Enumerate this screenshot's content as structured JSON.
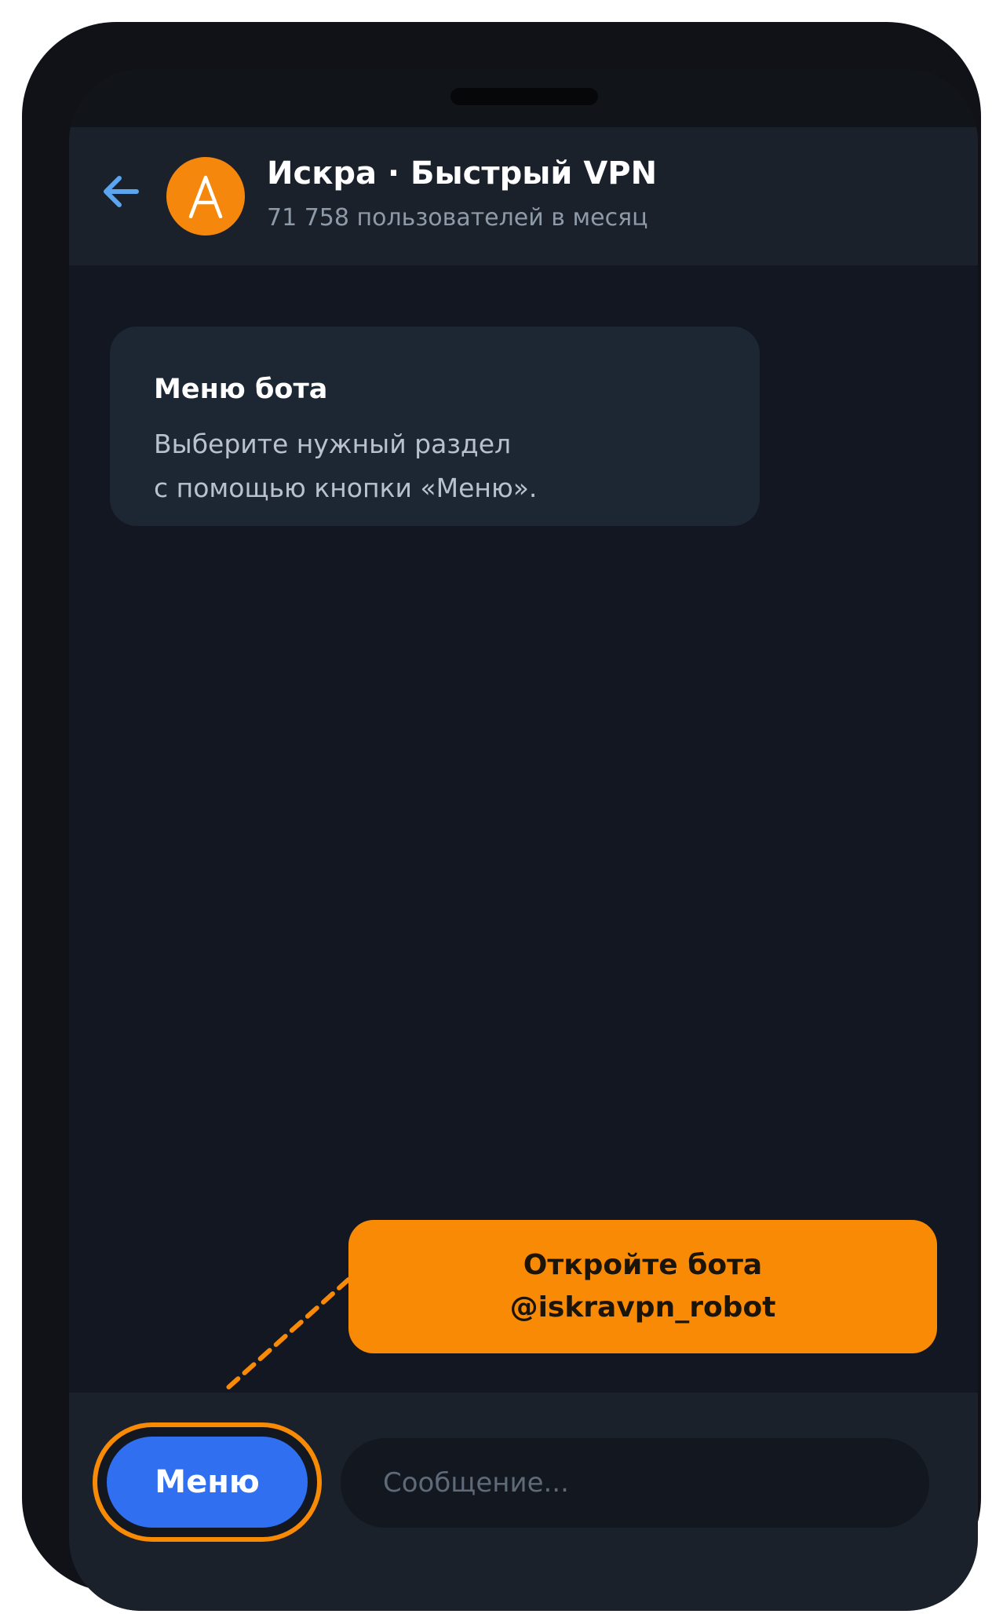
{
  "header": {
    "title": "Искра · Быстрый VPN",
    "subtitle": "71 758 пользователей в месяц",
    "avatar_icon": "letter-a-icon",
    "back_icon": "arrow-left-icon"
  },
  "message": {
    "title": "Меню бота",
    "text": "Выберите нужный раздел\nс помощью кнопки «Меню»."
  },
  "callout": {
    "line1": "Откройте бота",
    "line2": "@iskravpn_robot"
  },
  "input_bar": {
    "menu_label": "Меню",
    "message_placeholder": "Сообщение...",
    "message_value": ""
  },
  "colors": {
    "accent_orange": "#f98a05",
    "button_blue": "#2f6ff0",
    "back_arrow": "#5aa4f0",
    "background": "#131721",
    "header": "#1a212b"
  }
}
